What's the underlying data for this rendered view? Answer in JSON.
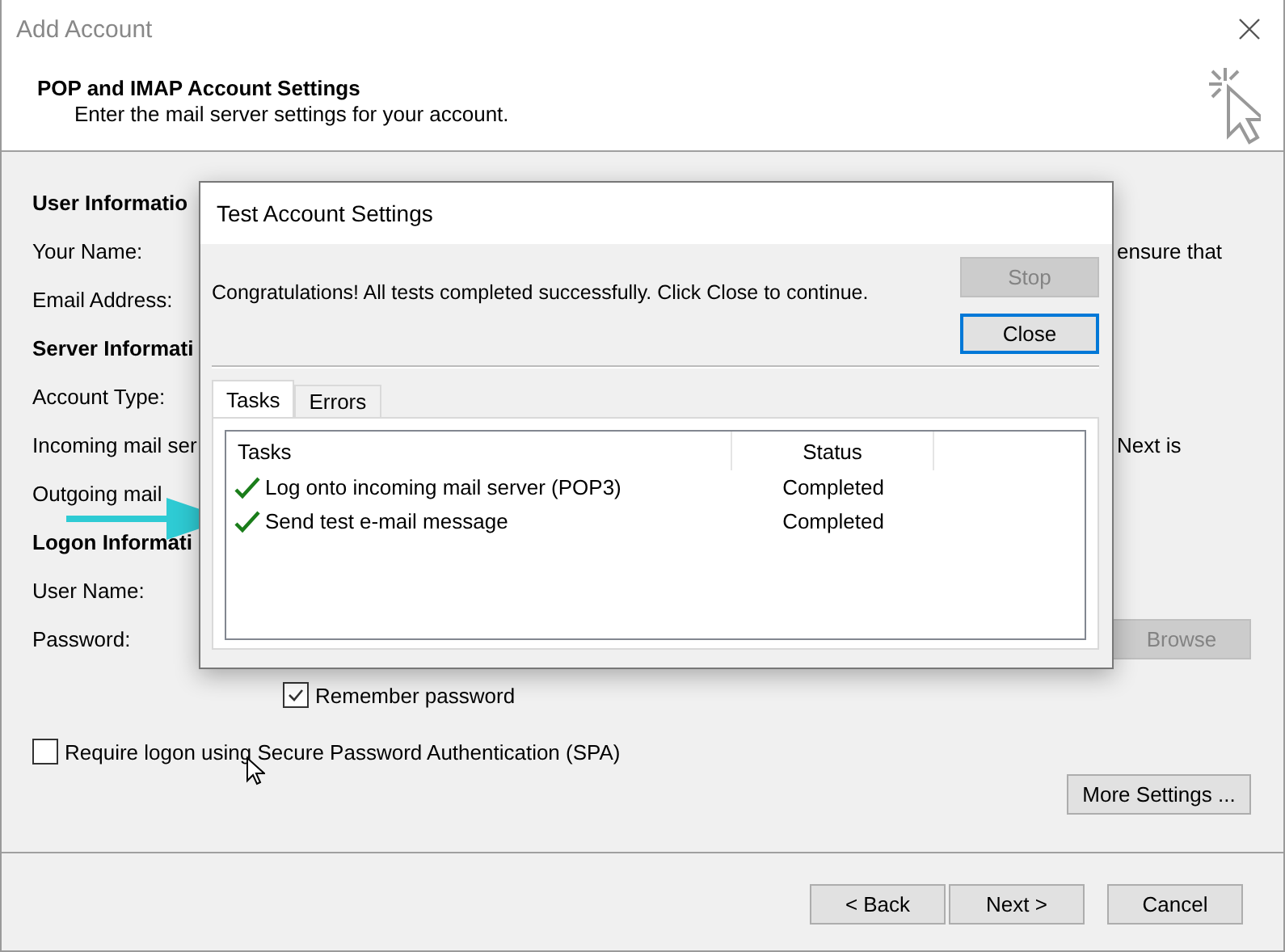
{
  "window": {
    "title": "Add Account"
  },
  "header": {
    "title": "POP and IMAP Account Settings",
    "subtitle": "Enter the mail server settings for your account."
  },
  "form_rows": [
    {
      "kind": "heading",
      "text": "User Informatio"
    },
    {
      "kind": "label",
      "text": "Your Name:",
      "note": "ensure that"
    },
    {
      "kind": "label",
      "text": "Email Address:"
    },
    {
      "kind": "heading",
      "text": "Server Informati"
    },
    {
      "kind": "label",
      "text": "Account Type:"
    },
    {
      "kind": "label",
      "text": "Incoming mail ser",
      "note": "Next is"
    },
    {
      "kind": "label",
      "text": "Outgoing mail"
    },
    {
      "kind": "heading",
      "text": "Logon Informati"
    },
    {
      "kind": "label",
      "text": "User Name:"
    },
    {
      "kind": "label",
      "text": "Password:",
      "button": {
        "label": "Browse",
        "disabled": true
      }
    }
  ],
  "remember_password": {
    "label": "Remember password",
    "checked": true
  },
  "spa": {
    "label": "Require logon using Secure Password Authentication (SPA)",
    "checked": false
  },
  "more_settings": {
    "label": "More Settings ..."
  },
  "footer_buttons": [
    {
      "label": "< Back"
    },
    {
      "label": "Next >"
    },
    {
      "label": "Cancel"
    }
  ],
  "dialog": {
    "title": "Test Account Settings",
    "message": "Congratulations! All tests completed successfully. Click Close to continue.",
    "buttons": [
      {
        "label": "Stop",
        "disabled": true,
        "default": false
      },
      {
        "label": "Close",
        "disabled": false,
        "default": true
      }
    ],
    "tabs": [
      {
        "label": "Tasks",
        "selected": true
      },
      {
        "label": "Errors",
        "selected": false
      }
    ],
    "columns": [
      "Tasks",
      "Status"
    ],
    "rows": [
      {
        "task": "Log onto incoming mail server (POP3)",
        "status": "Completed",
        "done": true
      },
      {
        "task": "Send test e-mail message",
        "status": "Completed",
        "done": true
      }
    ]
  }
}
